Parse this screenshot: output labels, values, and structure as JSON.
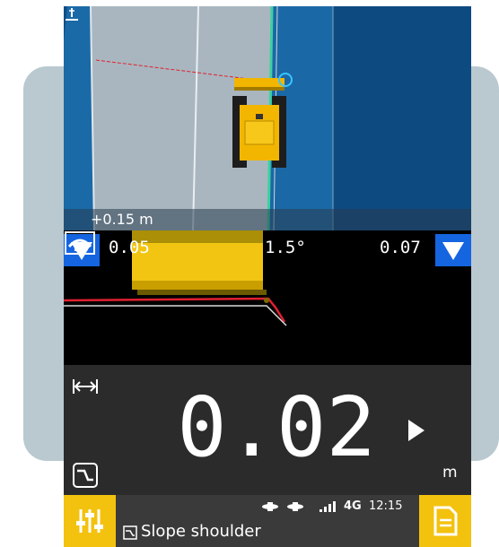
{
  "plan_view": {
    "height_offset": "+0.15 m"
  },
  "profile_view": {
    "left_value": "0.05",
    "cross_slope": "1.5°",
    "right_value": "0.07"
  },
  "readout": {
    "main_value": "0.02",
    "unit": "m"
  },
  "status_bar": {
    "network": "4G",
    "time": "12:15"
  },
  "mode": {
    "label": "Slope shoulder"
  },
  "colors": {
    "accent_yellow": "#f3c20f",
    "accent_blue": "#1565e0",
    "design_line_red": "#e02030"
  },
  "icons": [
    "height-offset-icon",
    "triangle-down-icon",
    "cross-slope-icon",
    "width-arrows-icon",
    "play-icon",
    "profile-icon",
    "settings-sliders-icon",
    "report-icon",
    "gnss-icon",
    "signal-icon",
    "slope-shoulder-icon"
  ]
}
